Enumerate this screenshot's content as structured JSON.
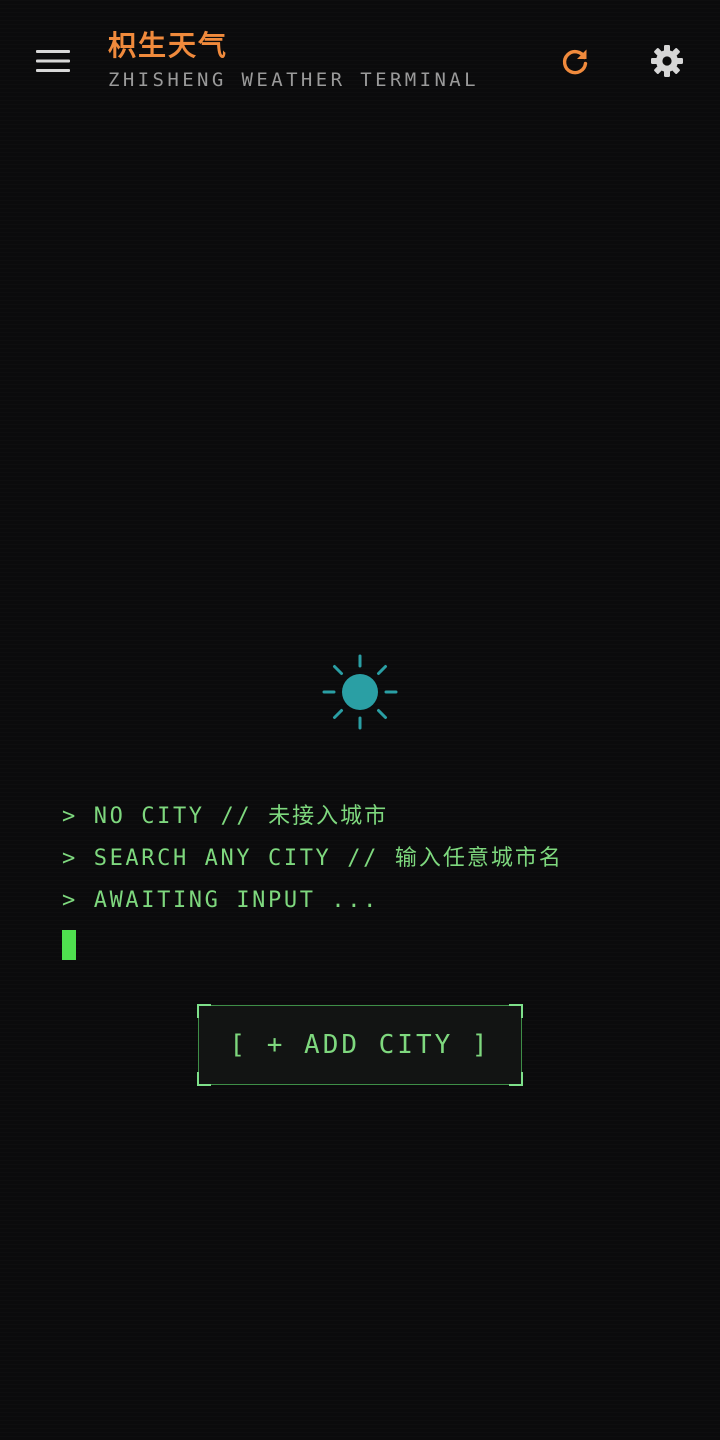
{
  "app_bar": {
    "title": "枳生天气",
    "subtitle": "ZHISHENG WEATHER TERMINAL",
    "menu_icon": "hamburger-menu-icon",
    "refresh_icon": "refresh-icon",
    "settings_icon": "gear-icon"
  },
  "empty_state": {
    "icon": "sun-icon",
    "lines": [
      {
        "prompt": ">",
        "text": "NO CITY",
        "sep": "//",
        "cn": "未接入城市"
      },
      {
        "prompt": ">",
        "text": "SEARCH ANY CITY",
        "sep": "//",
        "cn": "输入任意城市名"
      },
      {
        "prompt": ">",
        "text": "AWAITING INPUT ..."
      }
    ]
  },
  "add_city_button": {
    "label": "[ + ADD CITY ]"
  },
  "colors": {
    "background": "#0b0b0c",
    "accent_orange": "#f08a3c",
    "terminal_green": "#7ed87e",
    "cursor_green": "#4fe04f",
    "sun_teal": "#2a9fa4",
    "subtitle_gray": "#9a9a9a",
    "settings_gray": "#d6d6d6"
  }
}
